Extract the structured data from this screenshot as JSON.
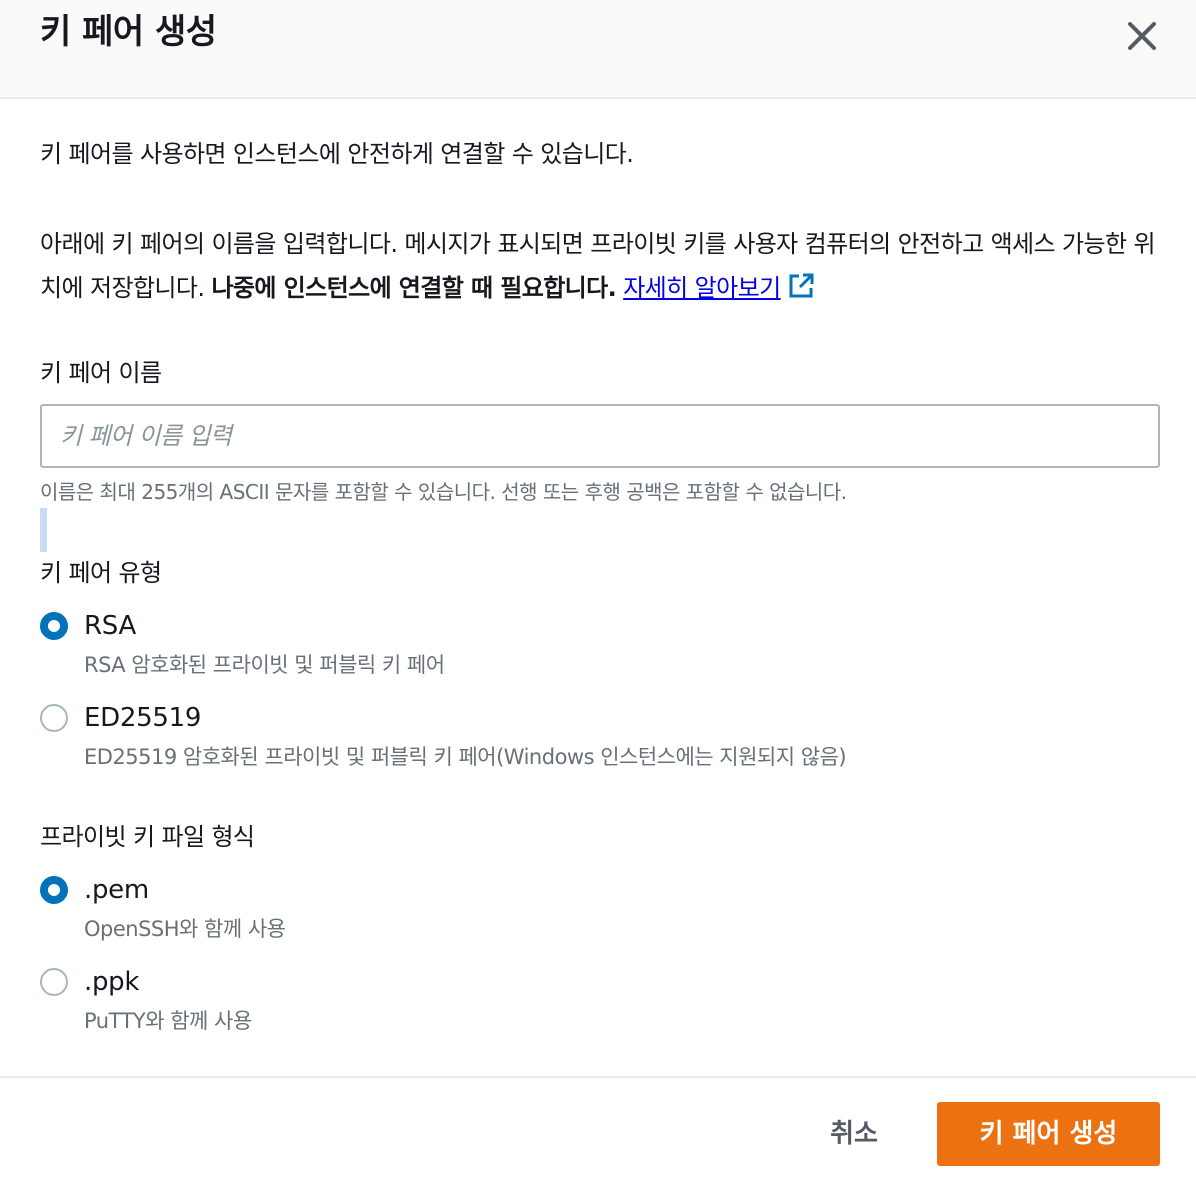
{
  "dialog": {
    "title": "키 페어 생성",
    "close_icon": "close-icon"
  },
  "intro": "키 페어를 사용하면 인스턴스에 안전하게 연결할 수 있습니다.",
  "description": {
    "text": "아래에 키 페어의 이름을 입력합니다. 메시지가 표시되면 프라이빗 키를 사용자 컴퓨터의 안전하고 액세스 가능한 위치에 저장합니다.",
    "bold": "나중에 인스턴스에 연결할 때 필요합니다.",
    "link": "자세히 알아보기",
    "link_icon": "external-link-icon"
  },
  "key_name": {
    "label": "키 페어 이름",
    "placeholder": "키 페어 이름 입력",
    "value": "",
    "hint": "이름은 최대 255개의 ASCII 문자를 포함할 수 있습니다. 선행 또는 후행 공백은 포함할 수 없습니다."
  },
  "key_type": {
    "label": "키 페어 유형",
    "options": [
      {
        "label": "RSA",
        "desc": "RSA 암호화된 프라이빗 및 퍼블릭 키 페어",
        "checked": true
      },
      {
        "label": "ED25519",
        "desc": "ED25519 암호화된 프라이빗 및 퍼블릭 키 페어(Windows 인스턴스에는 지원되지 않음)",
        "checked": false
      }
    ]
  },
  "file_format": {
    "label": "프라이빗 키 파일 형식",
    "options": [
      {
        "label": ".pem",
        "desc": "OpenSSH와 함께 사용",
        "checked": true
      },
      {
        "label": ".ppk",
        "desc": "PuTTY와 함께 사용",
        "checked": false
      }
    ]
  },
  "footer": {
    "cancel": "취소",
    "create": "키 페어 생성"
  },
  "colors": {
    "primary_button": "#ec7211",
    "radio_checked": "#0073bb",
    "link": "#0000ee"
  }
}
